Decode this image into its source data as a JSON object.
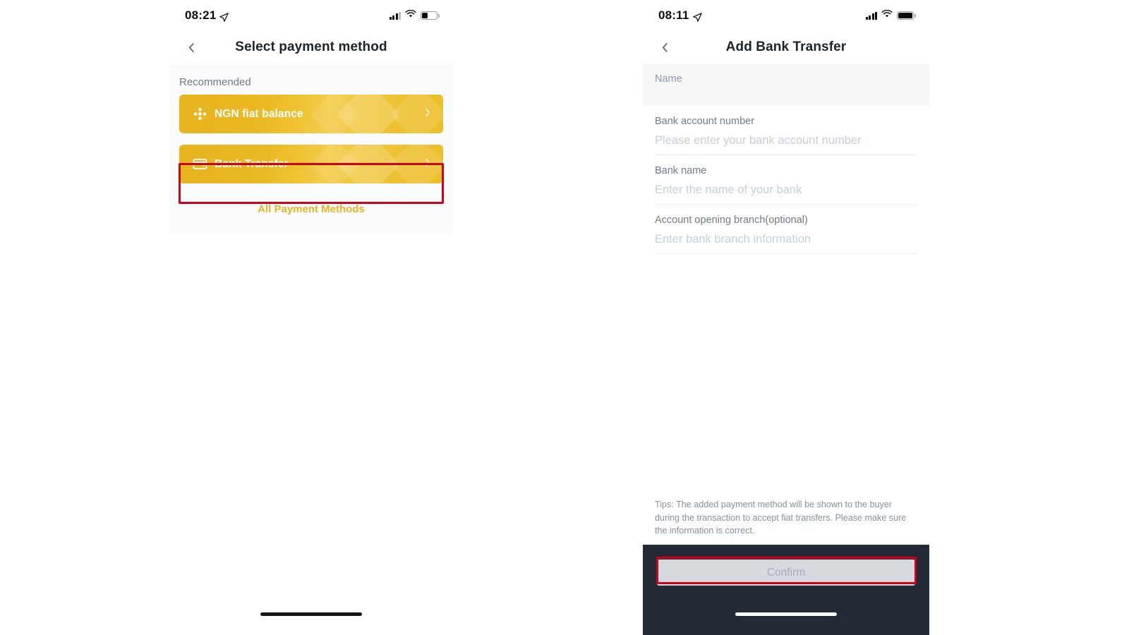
{
  "left_panel": {
    "status_bar": {
      "time": "08:21",
      "location_icon": "location-arrow-icon",
      "signal_icon": "cellular-signal-icon",
      "wifi_icon": "wifi-icon",
      "battery_icon": "battery-icon",
      "battery_level_percent": 40
    },
    "nav": {
      "back_icon": "chevron-left-icon",
      "title": "Select payment method"
    },
    "section_label": "Recommended",
    "methods": [
      {
        "label": "NGN fiat balance",
        "icon": "binance-diamond-icon",
        "chevron": "chevron-right-icon"
      },
      {
        "label": "Bank Transfer",
        "icon": "bank-card-icon",
        "chevron": "chevron-right-icon"
      }
    ],
    "all_methods_link": "All Payment Methods",
    "accent_color": "#e6b320"
  },
  "right_panel": {
    "status_bar": {
      "time": "08:11",
      "location_icon": "location-arrow-icon",
      "signal_icon": "cellular-signal-icon",
      "wifi_icon": "wifi-icon",
      "battery_icon": "battery-icon",
      "battery_level_percent": 100
    },
    "nav": {
      "back_icon": "chevron-left-icon",
      "title": "Add Bank Transfer"
    },
    "fields": [
      {
        "label": "Name",
        "value": "",
        "placeholder": ""
      },
      {
        "label": "Bank account number",
        "value": "",
        "placeholder": "Please enter your bank account number"
      },
      {
        "label": "Bank name",
        "value": "",
        "placeholder": "Enter the name of your bank"
      },
      {
        "label": "Account opening branch(optional)",
        "value": "",
        "placeholder": "Enter bank branch information"
      }
    ],
    "tips": "Tips: The added payment method will be shown to the buyer during the transaction to accept fiat transfers. Please make sure the information is correct.",
    "confirm_label": "Confirm",
    "footer_color": "#212a35"
  },
  "annotations": {
    "color": "#d0021b",
    "boxes": [
      {
        "name": "bank-transfer-highlight"
      },
      {
        "name": "confirm-button-highlight"
      }
    ]
  }
}
